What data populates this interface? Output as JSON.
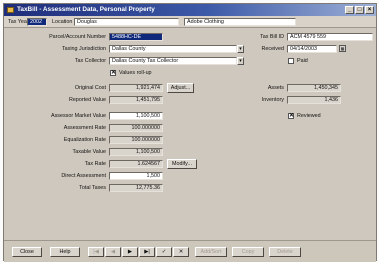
{
  "window": {
    "title": "TaxBill - Assessment Data, Personal Property",
    "icon": "app-icon"
  },
  "header": {
    "tax_year_label": "Tax Year",
    "tax_year_value": "2002",
    "location_label": "Location",
    "location_value": "Douglas",
    "business_value": "Adobe Clothing"
  },
  "left": {
    "parcel_label": "Parcel/Account Number",
    "parcel_value": "5488HC-DE",
    "taxing_label": "Taxing Jurisdiction",
    "taxing_value": "Dallas County",
    "collector_label": "Tax Collector",
    "collector_value": "Dallas County Tax Collector",
    "values_rollup_label": "Values roll-up",
    "values_rollup_checked": true,
    "original_cost_label": "Original Cost",
    "original_cost_value": "1,921,474",
    "reported_value_label": "Reported Value",
    "reported_value_value": "1,451,795",
    "adjust_label": "Adjust...",
    "assessor_label": "Assessor Market Value",
    "assessor_value": "1,100,500",
    "assessment_rate_label": "Assessment Rate",
    "assessment_rate_value": "100.000000",
    "equalization_label": "Equalization Rate",
    "equalization_value": "100.000000",
    "taxable_label": "Taxable Value",
    "taxable_value": "1,100,500",
    "tax_rate_label": "Tax Rate",
    "tax_rate_value": "1.624567",
    "modify_label": "Modify...",
    "direct_label": "Direct Assessment",
    "direct_value": "1,500",
    "total_taxes_label": "Total Taxes",
    "total_taxes_value": "12,775.36"
  },
  "right": {
    "taxbill_id_label": "Tax Bill ID",
    "taxbill_id_value": "ACM 4579 559",
    "received_label": "Received",
    "received_value": "04/14/2003",
    "paid_label": "Paid",
    "paid_checked": false,
    "assets_label": "Assets",
    "assets_value": "1,450,345",
    "inventory_label": "Inventory",
    "inventory_value": "1,436",
    "reviewed_label": "Reviewed",
    "reviewed_checked": true
  },
  "toolbar": {
    "close_label": "Close",
    "help_label": "Help",
    "first_label": "|◀",
    "prev_label": "◀",
    "next_label": "▶",
    "last_label": "▶|",
    "save_glyph": "✓",
    "cancel_glyph": "✕",
    "add_label": "Add/Sort",
    "copy_label": "Copy",
    "delete_label": "Delete"
  },
  "icons": {
    "minimize": "minimize-icon",
    "maximize": "maximize-icon",
    "close": "close-icon",
    "calendar": "calendar-icon"
  },
  "colors": {
    "title_bar": "#1e2d7a",
    "window_bg": "#cfc8be",
    "selection": "#0f2a7a"
  }
}
